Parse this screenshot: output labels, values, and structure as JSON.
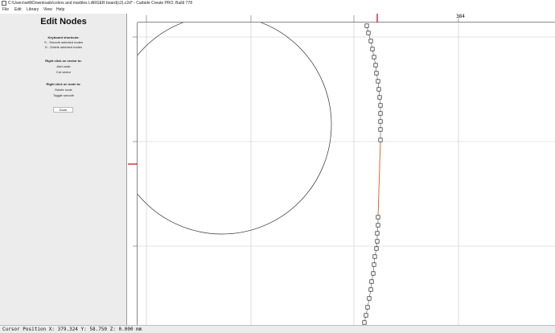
{
  "window": {
    "title": "C:\\Users\\willi\\Downloads\\colors and marbles LARGER board(c2).c2d* - Carbide Create PRO, Build 778"
  },
  "menu": {
    "file": "File",
    "edit": "Edit",
    "library": "Library",
    "view": "View",
    "help": "Help"
  },
  "panel": {
    "heading": "Edit Nodes",
    "shortcuts_title": "Keyboard shortcuts:",
    "shortcut_smooth": "S - Smooth selected nodes",
    "shortcut_delete": "D - Delete selected nodes",
    "vector_title": "Right click on vector to:",
    "vector_add": "Add node",
    "vector_cut": "Cut vector",
    "node_title": "Right click on node to:",
    "node_delete": "Delete node",
    "node_smooth": "Toggle smooth",
    "done_label": "Done"
  },
  "ruler": {
    "top_label": "384"
  },
  "status": {
    "cursor_text": "Cursor Position X: 379.324 Y: 58.750 Z: 0.000 mm"
  },
  "colors": {
    "panel_bg": "#ececec",
    "grid": "#c8c8c8",
    "selected_path": "#e8641e",
    "cursor_marker": "#e31c2b",
    "vector": "#333333"
  }
}
